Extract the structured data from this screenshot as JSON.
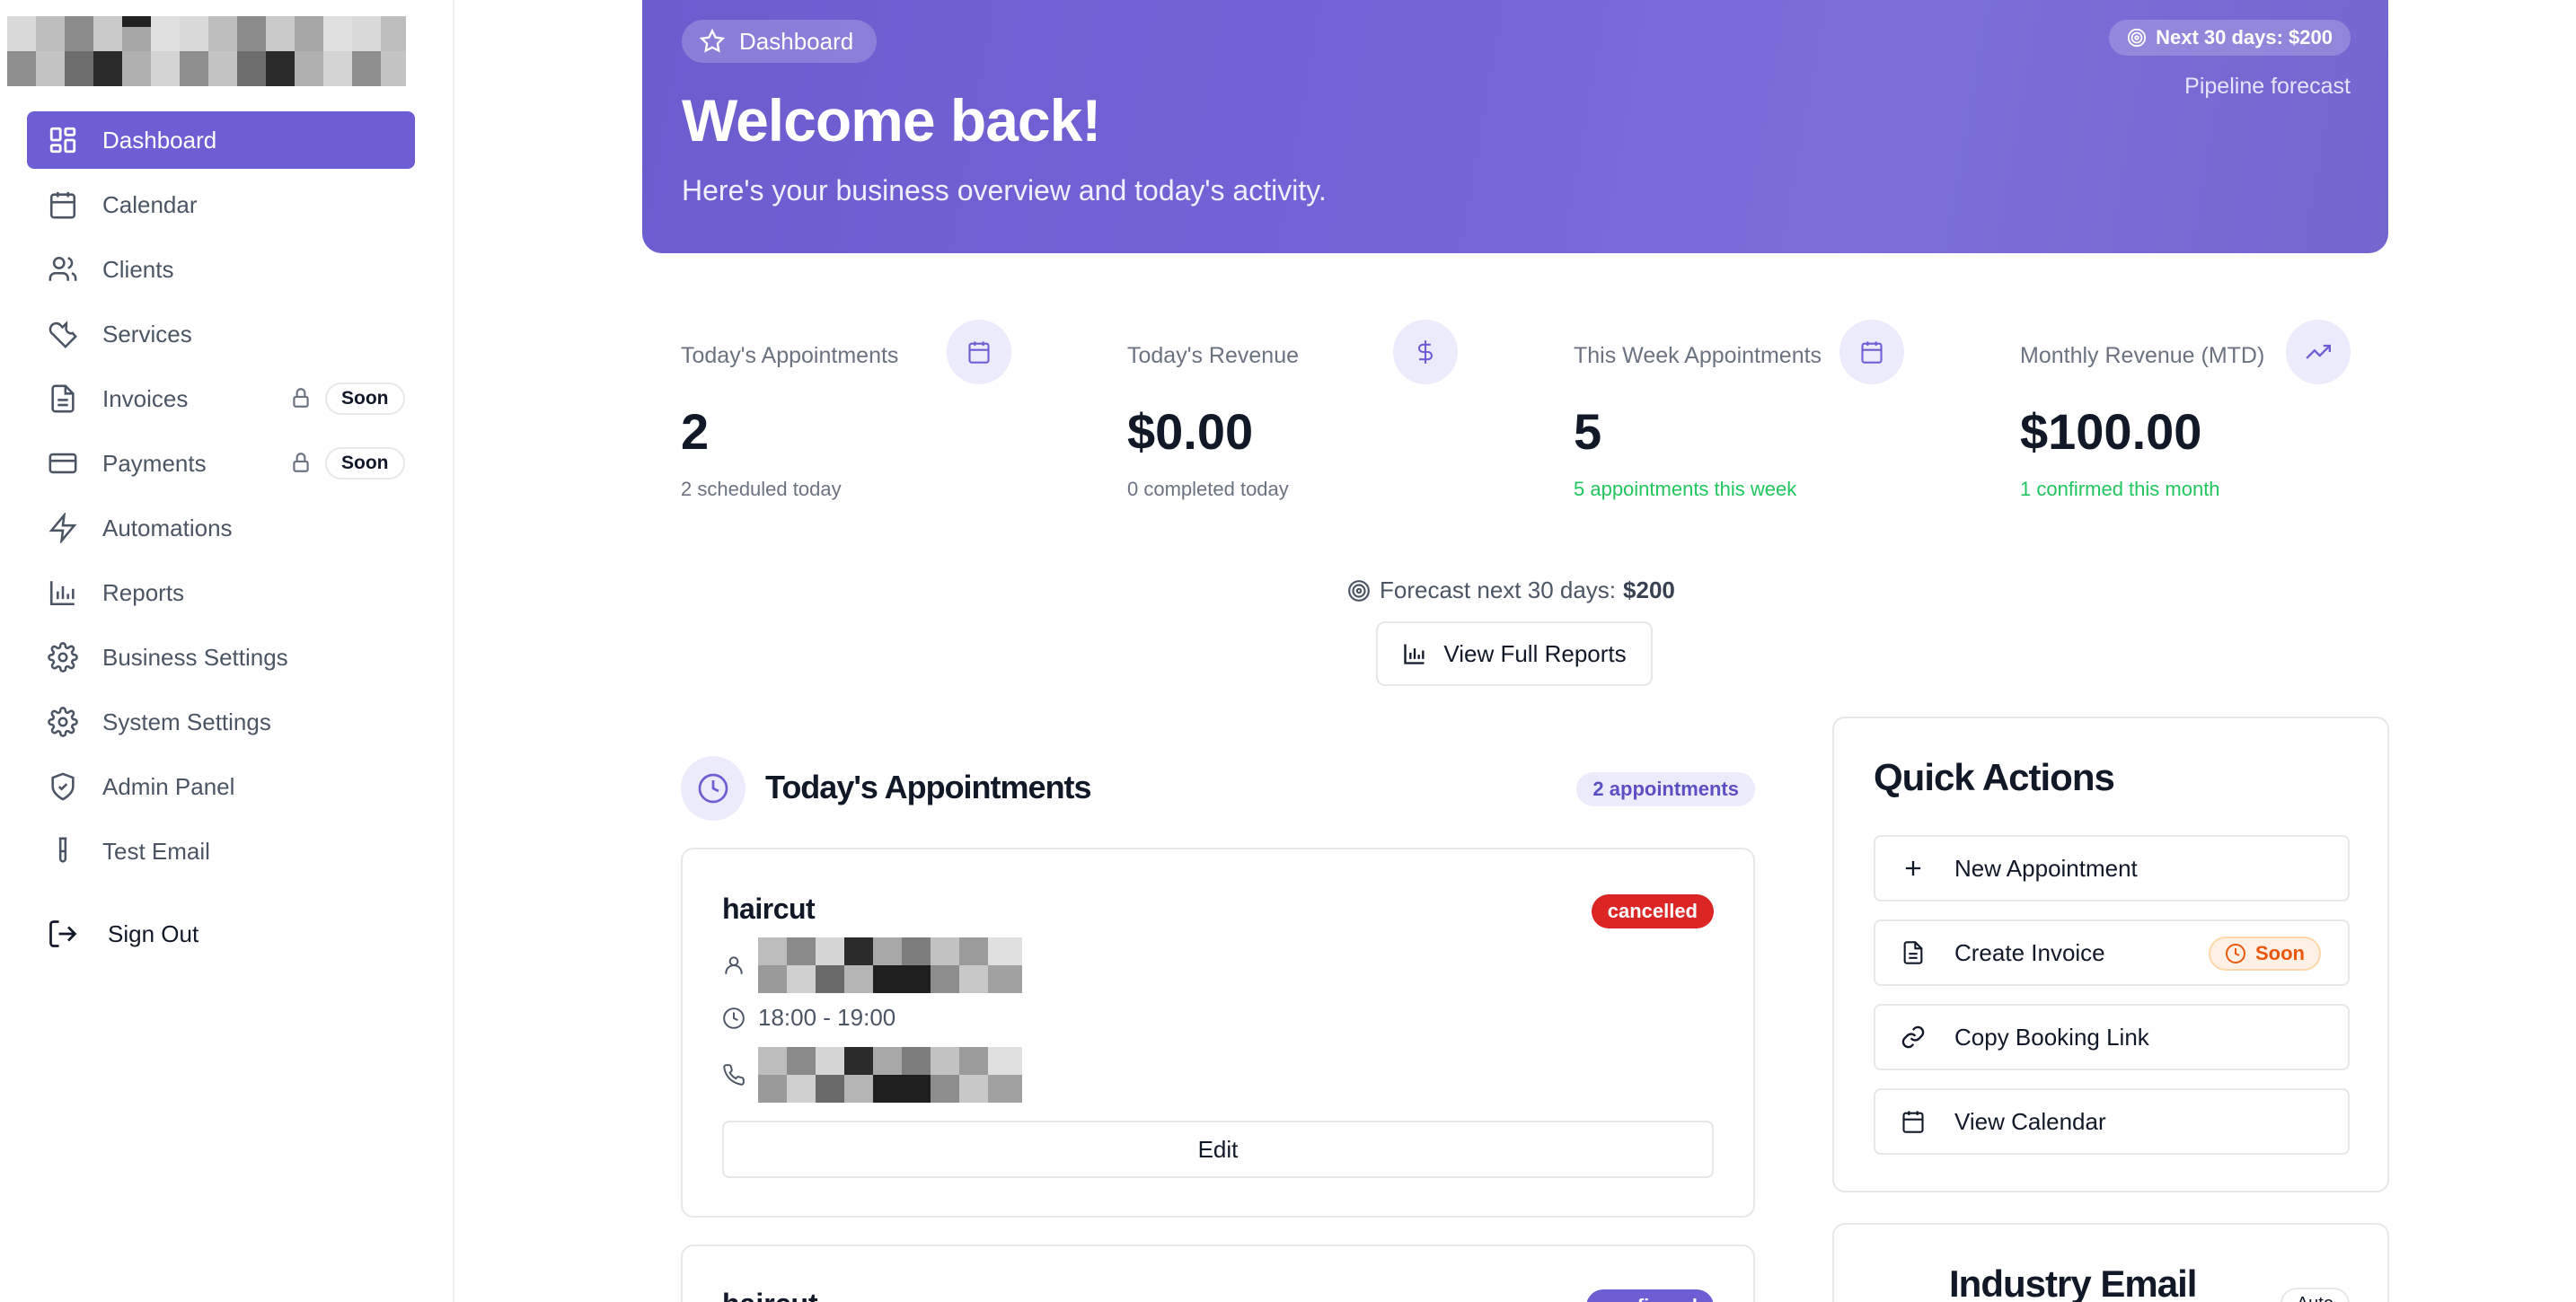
{
  "sidebar": {
    "items": [
      {
        "label": "Dashboard"
      },
      {
        "label": "Calendar"
      },
      {
        "label": "Clients"
      },
      {
        "label": "Services"
      },
      {
        "label": "Invoices",
        "badge": "Soon"
      },
      {
        "label": "Payments",
        "badge": "Soon"
      },
      {
        "label": "Automations"
      },
      {
        "label": "Reports"
      },
      {
        "label": "Business Settings"
      },
      {
        "label": "System Settings"
      },
      {
        "label": "Admin Panel"
      },
      {
        "label": "Test Email"
      }
    ],
    "sign_out": "Sign Out"
  },
  "hero": {
    "pill": "Dashboard",
    "title": "Welcome back!",
    "subtitle": "Here's your business overview and today's activity.",
    "forecast_pill": "Next 30 days: $200",
    "pipeline": "Pipeline forecast"
  },
  "stats": [
    {
      "label": "Today's Appointments",
      "value": "2",
      "note": "2 scheduled today",
      "icon": "calendar-icon"
    },
    {
      "label": "Today's Revenue",
      "value": "$0.00",
      "note": "0 completed today",
      "icon": "dollar-icon"
    },
    {
      "label": "This Week Appointments",
      "value": "5",
      "note": "5 appointments this week",
      "icon": "calendar-grid-icon"
    },
    {
      "label": "Monthly Revenue (MTD)",
      "value": "$100.00",
      "note": "1 confirmed this month",
      "icon": "trending-up-icon"
    }
  ],
  "forecast": {
    "label": "Forecast next 30 days:",
    "value": "$200"
  },
  "view_reports": "View Full Reports",
  "appointments": {
    "title": "Today's Appointments",
    "count": "2 appointments",
    "items": [
      {
        "service": "haircut",
        "status": "cancelled",
        "time": "18:00 - 19:00",
        "edit": "Edit"
      },
      {
        "service": "haircut",
        "status": "confirmed"
      }
    ]
  },
  "quick_actions": {
    "title": "Quick Actions",
    "items": [
      {
        "label": "New Appointment"
      },
      {
        "label": "Create Invoice",
        "badge": "Soon"
      },
      {
        "label": "Copy Booking Link"
      },
      {
        "label": "View Calendar"
      }
    ]
  },
  "industry_email": {
    "title": "Industry Email",
    "badge": "Auto"
  },
  "colors": {
    "accent": "#6d5fd3",
    "danger": "#dc2626",
    "success": "#22c55e",
    "warning": "#ea580c"
  }
}
